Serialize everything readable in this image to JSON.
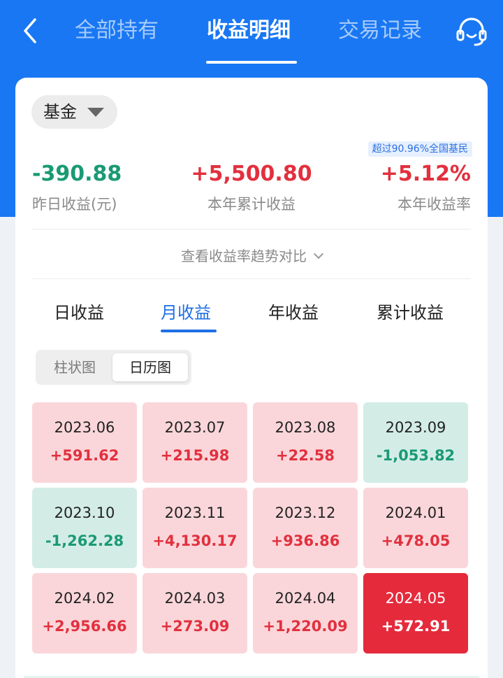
{
  "header": {
    "tabs": [
      {
        "label": "全部持有"
      },
      {
        "label": "收益明细"
      },
      {
        "label": "交易记录"
      }
    ],
    "active_tab": "收益明细",
    "accent_color": "#1977f3"
  },
  "filter": {
    "asset_type": "基金"
  },
  "summary": {
    "rank_badge": "超过90.96%全国基民",
    "yesterday": {
      "value": "-390.88",
      "label": "昨日收益(元)"
    },
    "ytd_profit": {
      "value": "+5,500.80",
      "label": "本年累计收益"
    },
    "ytd_rate": {
      "value": "+5.12%",
      "label": "本年收益率"
    }
  },
  "trend_link": "查看收益率趋势对比",
  "period_tabs": [
    "日收益",
    "月收益",
    "年收益",
    "累计收益"
  ],
  "active_period": "月收益",
  "view_toggle": [
    "柱状图",
    "日历图"
  ],
  "active_view": "日历图",
  "calendar": [
    {
      "month": "2023.06",
      "value": "+591.62",
      "state": "pos"
    },
    {
      "month": "2023.07",
      "value": "+215.98",
      "state": "pos"
    },
    {
      "month": "2023.08",
      "value": "+22.58",
      "state": "pos"
    },
    {
      "month": "2023.09",
      "value": "-1,053.82",
      "state": "neg"
    },
    {
      "month": "2023.10",
      "value": "-1,262.28",
      "state": "neg"
    },
    {
      "month": "2023.11",
      "value": "+4,130.17",
      "state": "pos"
    },
    {
      "month": "2023.12",
      "value": "+936.86",
      "state": "pos"
    },
    {
      "month": "2024.01",
      "value": "+478.05",
      "state": "pos"
    },
    {
      "month": "2024.02",
      "value": "+2,956.66",
      "state": "pos"
    },
    {
      "month": "2024.03",
      "value": "+273.09",
      "state": "pos"
    },
    {
      "month": "2024.04",
      "value": "+1,220.09",
      "state": "pos"
    },
    {
      "month": "2024.05",
      "value": "+572.91",
      "state": "current"
    }
  ],
  "colors": {
    "gain": "#e2303e",
    "loss": "#1a9a73",
    "gain_bg": "#fad6da",
    "loss_bg": "#d3ede6",
    "current_bg": "#e52a3c"
  }
}
